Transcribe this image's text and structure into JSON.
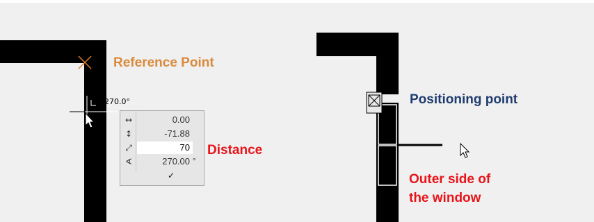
{
  "labels": {
    "reference_point": "Reference Point",
    "distance": "Distance",
    "positioning_point": "Positioning point",
    "outer_side_line1": "Outer side of",
    "outer_side_line2": "the window"
  },
  "angle_readout": "270.0°",
  "tracker": {
    "rows": [
      {
        "icon": "horizontal-arrows-icon",
        "glyph": "↔",
        "value": "0.00",
        "unit": ""
      },
      {
        "icon": "vertical-arrows-icon",
        "glyph": "↕",
        "value": "-71.88",
        "unit": ""
      },
      {
        "icon": "distance-icon",
        "glyph": "⤢",
        "value": "70",
        "unit": ""
      },
      {
        "icon": "angle-icon",
        "glyph": "∢",
        "value": "270.00",
        "unit": "°"
      }
    ],
    "confirm_glyph": "✓"
  },
  "colors": {
    "orange": "#d98a3c",
    "red": "#e8141a",
    "navy": "#1f3c6e",
    "wall": "#000000",
    "background": "#f0f0f0"
  }
}
